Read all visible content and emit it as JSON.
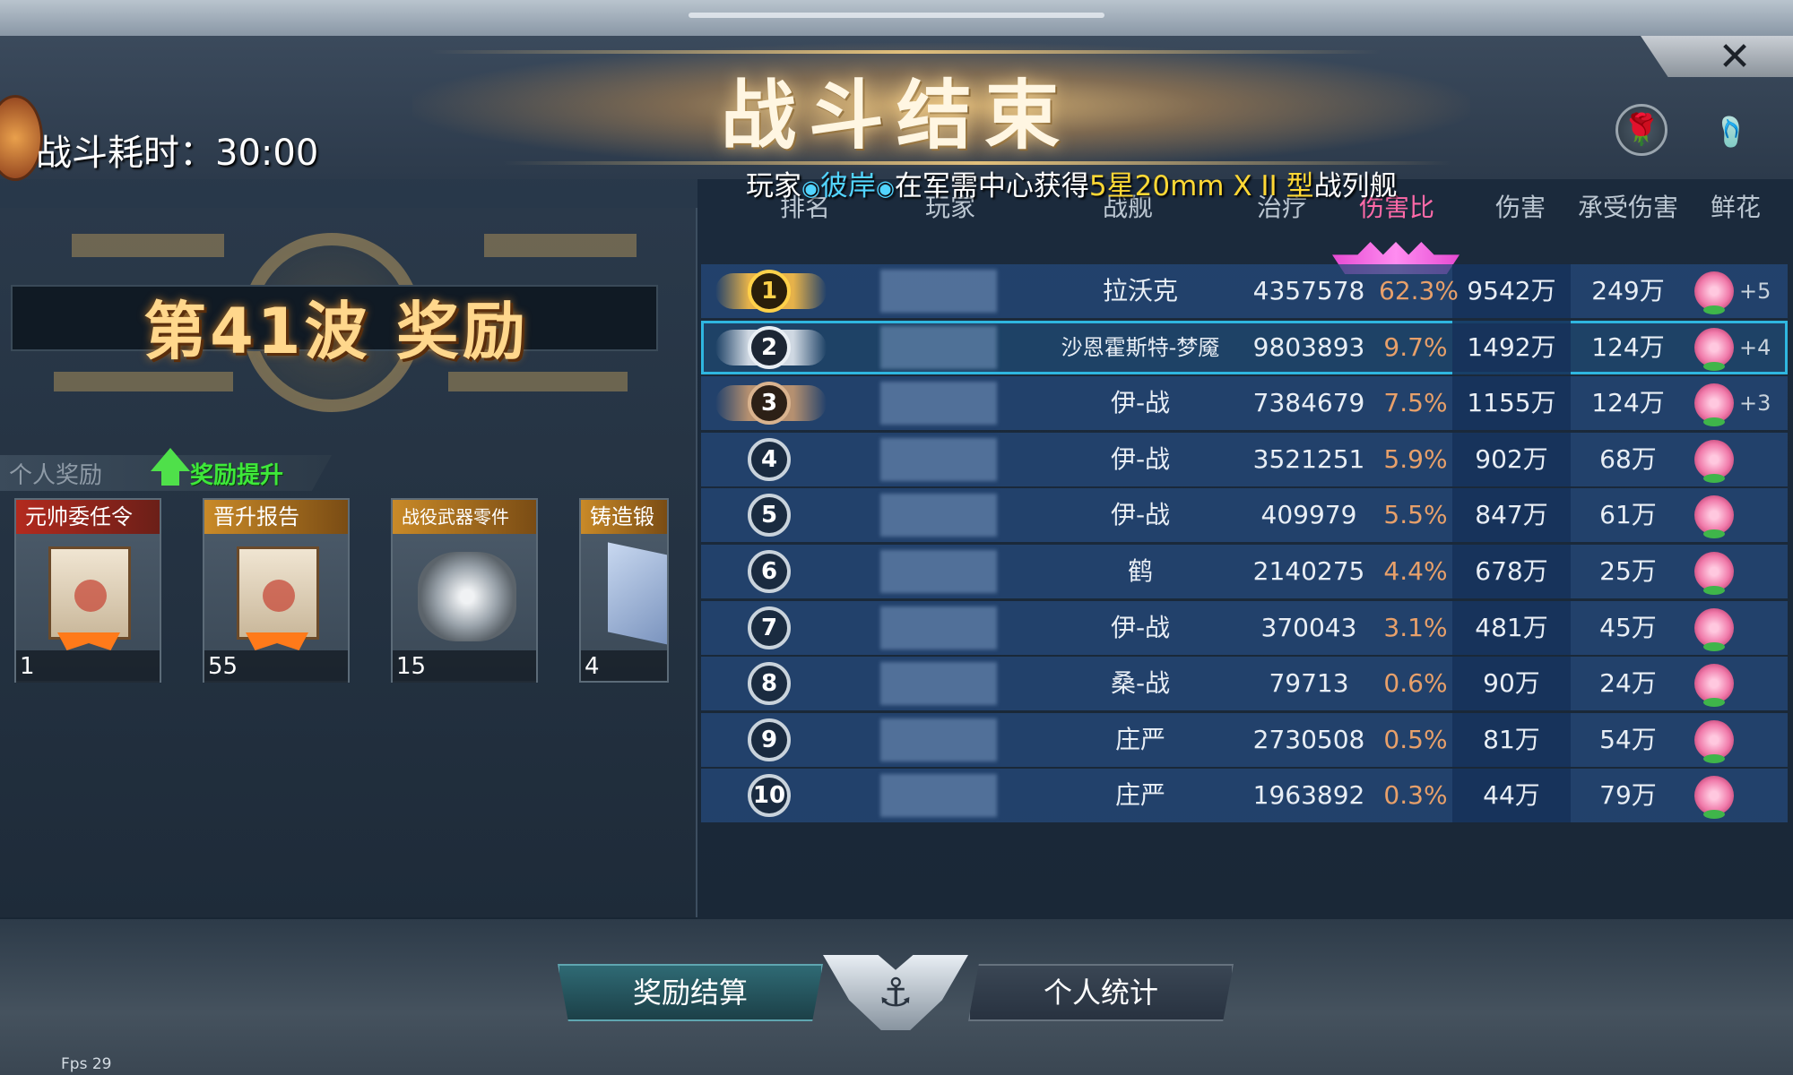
{
  "header": {
    "title": "战斗结束",
    "battle_time": "战斗耗时：30:00",
    "close_icon": "close-icon",
    "close_label": "✕",
    "rose_icon_label": "🌹",
    "slipper_icon_label": "🩴"
  },
  "marquee": {
    "prefix": "玩家",
    "player": "彼岸",
    "middle": "在军需中心获得",
    "item": "5星20mm X II 型",
    "suffix": "战列舰"
  },
  "wave": {
    "title": "第41波 奖励"
  },
  "rewards": {
    "tab_personal": "个人奖励",
    "tab_boost": "奖励提升",
    "items": [
      {
        "name": "元帅委任令",
        "qty": "1"
      },
      {
        "name": "晋升报告",
        "qty": "55"
      },
      {
        "name": "战役武器零件",
        "qty": "15"
      },
      {
        "name": "铸造锻",
        "qty": "4"
      }
    ]
  },
  "table": {
    "headers": [
      "排名",
      "玩家",
      "战舰",
      "治疗",
      "伤害比",
      "伤害",
      "承受伤害",
      "鲜花"
    ],
    "rows": [
      {
        "rank": "1",
        "ship": "拉沃克",
        "heal": "4357578",
        "pct": "62.3%",
        "dmg": "9542万",
        "taken": "249万",
        "flower_plus": "+5"
      },
      {
        "rank": "2",
        "ship": "沙恩霍斯特-梦魇",
        "heal": "9803893",
        "pct": "9.7%",
        "dmg": "1492万",
        "taken": "124万",
        "flower_plus": "+4"
      },
      {
        "rank": "3",
        "ship": "伊-战",
        "heal": "7384679",
        "pct": "7.5%",
        "dmg": "1155万",
        "taken": "124万",
        "flower_plus": "+3"
      },
      {
        "rank": "4",
        "ship": "伊-战",
        "heal": "3521251",
        "pct": "5.9%",
        "dmg": "902万",
        "taken": "68万",
        "flower_plus": ""
      },
      {
        "rank": "5",
        "ship": "伊-战",
        "heal": "409979",
        "pct": "5.5%",
        "dmg": "847万",
        "taken": "61万",
        "flower_plus": ""
      },
      {
        "rank": "6",
        "ship": "鹤",
        "heal": "2140275",
        "pct": "4.4%",
        "dmg": "678万",
        "taken": "25万",
        "flower_plus": ""
      },
      {
        "rank": "7",
        "ship": "伊-战",
        "heal": "370043",
        "pct": "3.1%",
        "dmg": "481万",
        "taken": "45万",
        "flower_plus": ""
      },
      {
        "rank": "8",
        "ship": "桑-战",
        "heal": "79713",
        "pct": "0.6%",
        "dmg": "90万",
        "taken": "24万",
        "flower_plus": ""
      },
      {
        "rank": "9",
        "ship": "庄严",
        "heal": "2730508",
        "pct": "0.5%",
        "dmg": "81万",
        "taken": "54万",
        "flower_plus": ""
      },
      {
        "rank": "10",
        "ship": "庄严",
        "heal": "1963892",
        "pct": "0.3%",
        "dmg": "44万",
        "taken": "79万",
        "flower_plus": ""
      }
    ]
  },
  "footer": {
    "btn_settle": "奖励结算",
    "btn_stats": "个人统计",
    "emblem_label": "⚓",
    "fps": "Fps 29"
  },
  "colors": {
    "accent_blue": "#52d4ff",
    "accent_yellow": "#ffd835",
    "boost_green": "#3ee83a",
    "pct_orange": "#e8a06a"
  }
}
